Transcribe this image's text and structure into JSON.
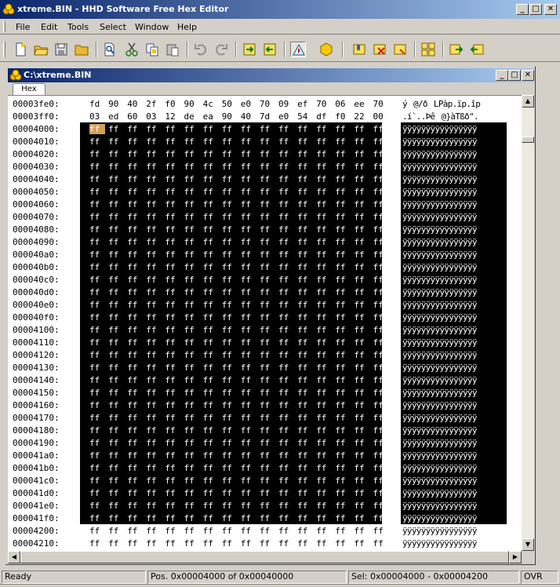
{
  "window": {
    "title": "xtreme.BIN - HHD Software Free Hex Editor"
  },
  "menu": [
    "File",
    "Edit",
    "Tools",
    "Select",
    "Window",
    "Help"
  ],
  "toolbar": {
    "buttons": [
      "new-file-icon",
      "open-folder-icon",
      "save-icon",
      "open-folder-2-icon",
      "find-icon",
      "cut-icon",
      "copy-icon",
      "paste-icon",
      "undo-icon",
      "redo-icon",
      "export-icon",
      "import-icon",
      "pattern-tool-icon",
      "hexagon-icon",
      "bookmark-add-icon",
      "bookmark-delete-icon",
      "bookmark-goto-icon",
      "window-tile-icon",
      "window-cascade-icon",
      "window-arrange-icon"
    ]
  },
  "document": {
    "title": "C:\\xtreme.BIN",
    "tab": "Hex"
  },
  "editor": {
    "selection_start_address": "00004000",
    "selection_end_address": "000041f0",
    "cursor_address": "00004000",
    "rows": [
      {
        "addr": "00003fe0:",
        "bytes": [
          "fd",
          "90",
          "40",
          "2f",
          "f0",
          "90",
          "4c",
          "50",
          "e0",
          "70",
          "09",
          "ef",
          "70",
          "06",
          "ee",
          "70"
        ],
        "ascii": "ý@/ðLPàp.ïp.îp"
      },
      {
        "addr": "00003ff0:",
        "bytes": [
          "03",
          "ed",
          "60",
          "03",
          "12",
          "de",
          "ea",
          "90",
          "40",
          "7d",
          "e0",
          "54",
          "df",
          "f0",
          "22",
          "00"
        ],
        "ascii": ".í`..Þê@}àTßð\"."
      },
      {
        "addr": "00004000:"
      },
      {
        "addr": "00004010:"
      },
      {
        "addr": "00004020:"
      },
      {
        "addr": "00004030:"
      },
      {
        "addr": "00004040:"
      },
      {
        "addr": "00004050:"
      },
      {
        "addr": "00004060:"
      },
      {
        "addr": "00004070:"
      },
      {
        "addr": "00004080:"
      },
      {
        "addr": "00004090:"
      },
      {
        "addr": "000040a0:"
      },
      {
        "addr": "000040b0:"
      },
      {
        "addr": "000040c0:"
      },
      {
        "addr": "000040d0:"
      },
      {
        "addr": "000040e0:"
      },
      {
        "addr": "000040f0:"
      },
      {
        "addr": "00004100:"
      },
      {
        "addr": "00004110:"
      },
      {
        "addr": "00004120:"
      },
      {
        "addr": "00004130:"
      },
      {
        "addr": "00004140:"
      },
      {
        "addr": "00004150:"
      },
      {
        "addr": "00004160:"
      },
      {
        "addr": "00004170:"
      },
      {
        "addr": "00004180:"
      },
      {
        "addr": "00004190:"
      },
      {
        "addr": "000041a0:"
      },
      {
        "addr": "000041b0:"
      },
      {
        "addr": "000041c0:"
      },
      {
        "addr": "000041d0:"
      },
      {
        "addr": "000041e0:"
      },
      {
        "addr": "000041f0:"
      },
      {
        "addr": "00004200:"
      },
      {
        "addr": "00004210:"
      }
    ],
    "fill_byte": "ff",
    "fill_ascii": "ÿÿÿÿÿÿÿÿÿÿÿÿÿÿÿÿ"
  },
  "status": {
    "ready": "Ready",
    "position": "Pos. 0x00004000 of 0x00040000",
    "selection": "Sel: 0x00004000 - 0x00004200",
    "mode": "OVR"
  },
  "colors": {
    "titlebar": "#0a246a",
    "selection_bg": "#000000",
    "cursor_bg": "#d2a058"
  }
}
